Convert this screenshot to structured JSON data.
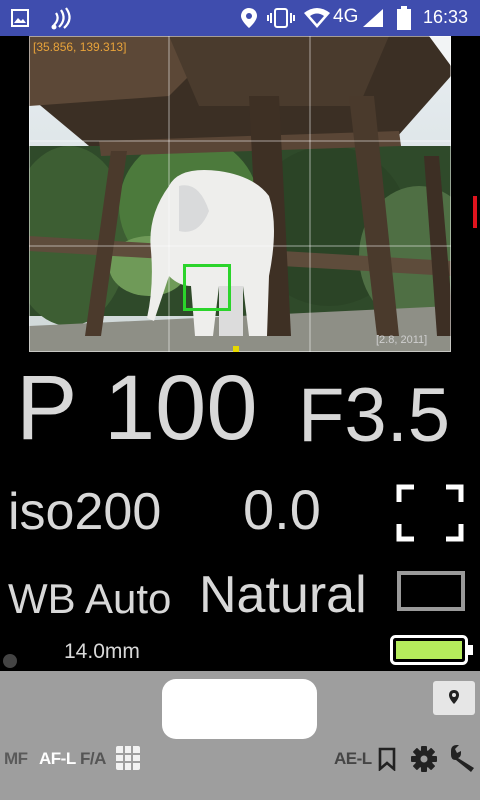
{
  "status_bar": {
    "network": "4G",
    "time": "16:33"
  },
  "viewfinder": {
    "coordinates": "[35.856, 139.313]",
    "dimensions": "[2.8, 2011]"
  },
  "readouts": {
    "mode": "P",
    "shutter": "100",
    "aperture": "F3.5",
    "iso": "iso200",
    "exposure_comp": "0.0",
    "white_balance": "WB Auto",
    "picture_style": "Natural",
    "focal_length": "14.0mm"
  },
  "battery_level": 1.0,
  "bottom_bar": {
    "mf": "MF",
    "af_lock": "AF-L",
    "fa": "F/A",
    "ae_lock": "AE-L"
  },
  "colors": {
    "status_bar": "#3f4dae",
    "focus_box": "#2bd42b",
    "battery": "#b5ec5c",
    "coordinates": "#e8a33a",
    "bottom_bar": "#9e9e9e"
  },
  "icons": [
    "gallery-icon",
    "nfc-icon",
    "location-icon",
    "vibrate-icon",
    "wifi-icon",
    "signal-icon",
    "battery-icon",
    "focus-frame-icon",
    "aspect-ratio-icon",
    "grid-icon",
    "bookmark-icon",
    "gear-icon",
    "wrench-icon",
    "map-pin-icon"
  ]
}
